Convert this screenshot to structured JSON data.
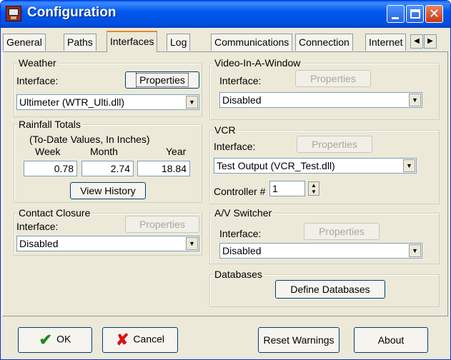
{
  "window": {
    "title": "Configuration"
  },
  "tabs": [
    "General",
    "Paths",
    "Interfaces",
    "Log",
    "Communications",
    "Connection",
    "Internet"
  ],
  "active_tab": "Interfaces",
  "weather": {
    "group_title": "Weather",
    "interface_label": "Interface:",
    "properties_label": "Properties",
    "selected": "Ultimeter (WTR_Ulti.dll)"
  },
  "rainfall": {
    "group_title": "Rainfall Totals",
    "subtitle": "(To-Date Values, In Inches)",
    "col_week": "Week",
    "col_month": "Month",
    "col_year": "Year",
    "week": "0.78",
    "month": "2.74",
    "year": "18.84",
    "history_label": "View History"
  },
  "contact": {
    "group_title": "Contact Closure",
    "interface_label": "Interface:",
    "properties_label": "Properties",
    "selected": "Disabled"
  },
  "video": {
    "group_title": "Video-In-A-Window",
    "interface_label": "Interface:",
    "properties_label": "Properties",
    "selected": "Disabled"
  },
  "vcr": {
    "group_title": "VCR",
    "interface_label": "Interface:",
    "properties_label": "Properties",
    "selected": "Test Output (VCR_Test.dll)",
    "controller_label": "Controller #",
    "controller_value": "1"
  },
  "av": {
    "group_title": "A/V Switcher",
    "interface_label": "Interface:",
    "properties_label": "Properties",
    "selected": "Disabled"
  },
  "databases": {
    "group_title": "Databases",
    "define_label": "Define Databases"
  },
  "footer": {
    "ok": "OK",
    "cancel": "Cancel",
    "reset": "Reset Warnings",
    "about": "About"
  }
}
